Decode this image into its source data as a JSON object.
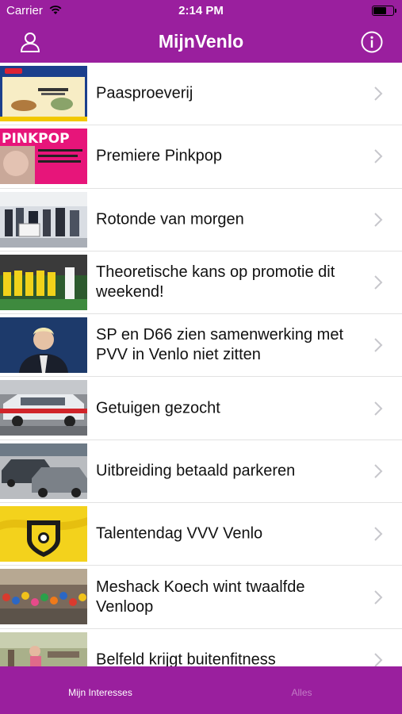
{
  "status_bar": {
    "carrier": "Carrier",
    "time": "2:14 PM",
    "battery_level": 0.6
  },
  "nav": {
    "title": "MijnVenlo",
    "left_icon": "person-icon",
    "right_icon": "info-icon"
  },
  "articles": [
    {
      "title": "Paasproeverij"
    },
    {
      "title": "Premiere Pinkpop",
      "thumb_text": "PINKPOP"
    },
    {
      "title": "Rotonde van morgen"
    },
    {
      "title": "Theoretische kans op promotie dit weekend!"
    },
    {
      "title": "SP en D66 zien samenwerking met PVV in Venlo niet zitten"
    },
    {
      "title": "Getuigen gezocht"
    },
    {
      "title": "Uitbreiding betaald parkeren"
    },
    {
      "title": "Talentendag VVV Venlo"
    },
    {
      "title": "Meshack Koech wint twaalfde Venloop"
    },
    {
      "title": "Belfeld krijgt buitenfitness"
    }
  ],
  "tabs": [
    {
      "label": "Mijn Interesses",
      "active": true
    },
    {
      "label": "Alles",
      "active": false
    }
  ],
  "colors": {
    "brand": "#9a1f9e",
    "tab_inactive": "#c37cc6",
    "chevron": "#c7c7cc"
  }
}
